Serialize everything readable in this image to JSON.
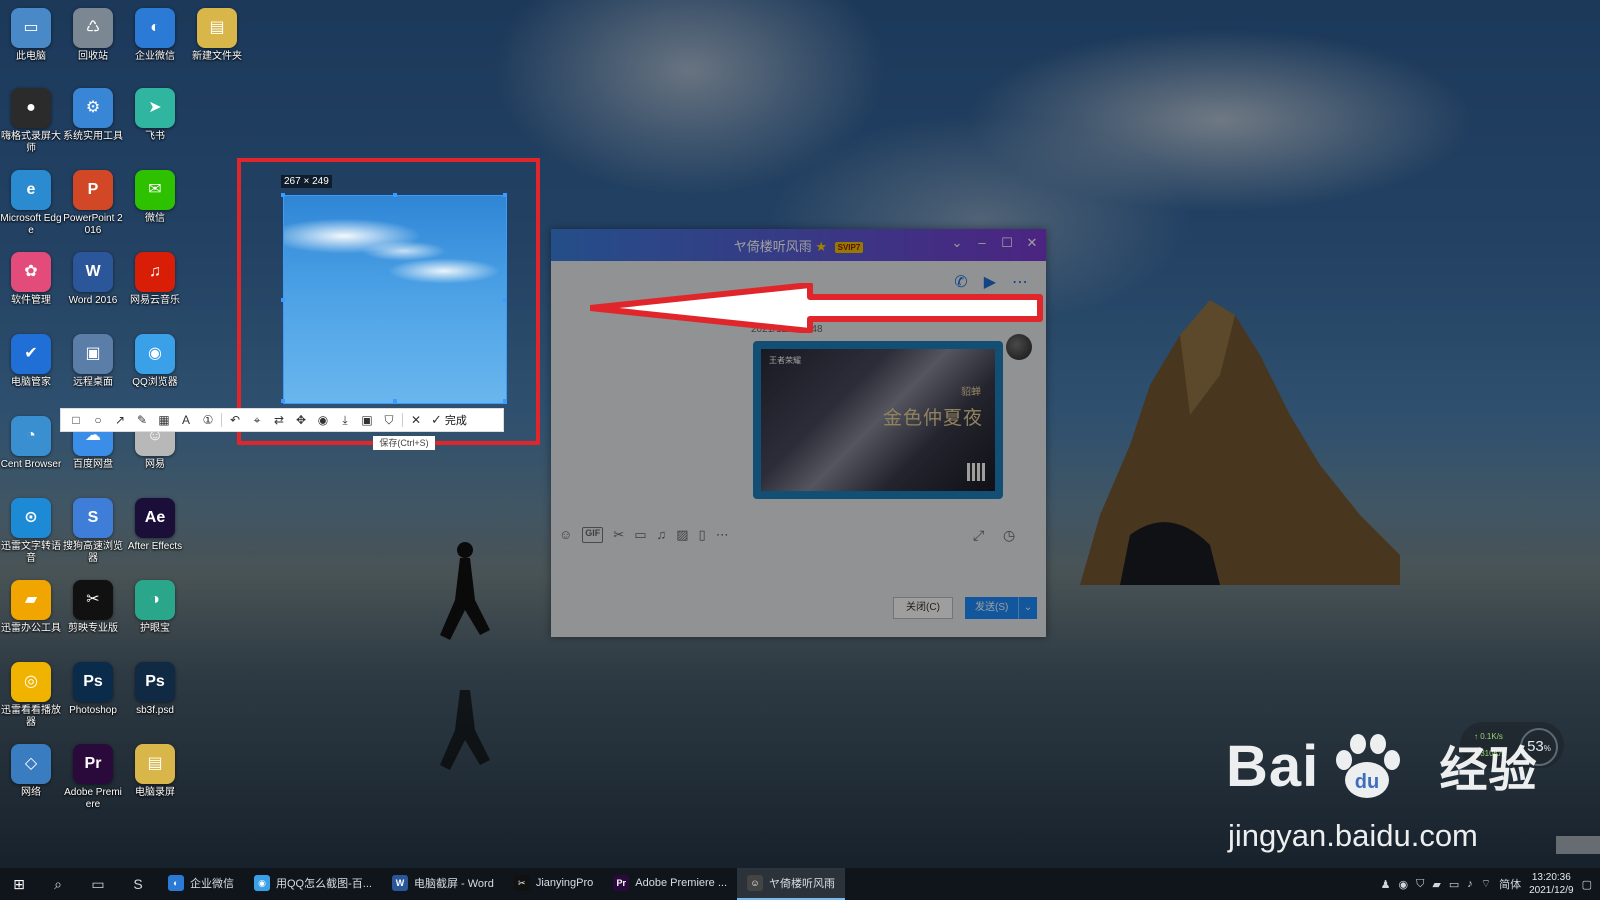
{
  "desktop": {
    "icons": [
      {
        "label": "此电脑",
        "glyph": "▭",
        "color": "#4a89c8"
      },
      {
        "label": "回收站",
        "glyph": "♺",
        "color": "#7b8792"
      },
      {
        "label": "企业微信",
        "glyph": "◐",
        "color": "#2b7bd6"
      },
      {
        "label": "新建文件夹",
        "glyph": "▤",
        "color": "#d9b64a"
      },
      {
        "label": "嗨格式录屏大师",
        "glyph": "●",
        "color": "#2b2b2b"
      },
      {
        "label": "系统实用工具",
        "glyph": "⚙",
        "color": "#3a86d6"
      },
      {
        "label": "飞书",
        "glyph": "➤",
        "color": "#2fb5a0"
      },
      {
        "label": "Microsoft Edge",
        "glyph": "e",
        "color": "#2a8bd0"
      },
      {
        "label": "PowerPoint 2016",
        "glyph": "P",
        "color": "#d24726"
      },
      {
        "label": "微信",
        "glyph": "✉",
        "color": "#2dc100"
      },
      {
        "label": "软件管理",
        "glyph": "✿",
        "color": "#e34b7a"
      },
      {
        "label": "Word 2016",
        "glyph": "W",
        "color": "#2b579a"
      },
      {
        "label": "网易云音乐",
        "glyph": "♫",
        "color": "#d81e06"
      },
      {
        "label": "电脑管家",
        "glyph": "✔",
        "color": "#1f6fd6"
      },
      {
        "label": "远程桌面",
        "glyph": "▣",
        "color": "#5a7ea8"
      },
      {
        "label": "QQ浏览器",
        "glyph": "◉",
        "color": "#3aa0e8"
      },
      {
        "label": "Cent Browser",
        "glyph": "◔",
        "color": "#3a8fd0"
      },
      {
        "label": "百度网盘",
        "glyph": "☁",
        "color": "#3a8ee8"
      },
      {
        "label": "网易",
        "glyph": "☺",
        "color": "#b8b8b8"
      },
      {
        "label": "迅雷文字转语音",
        "glyph": "⊙",
        "color": "#1d8ad6"
      },
      {
        "label": "搜狗高速浏览器",
        "glyph": "S",
        "color": "#3f7ed8"
      },
      {
        "label": "After Effects",
        "glyph": "Ae",
        "color": "#1b0f3a"
      },
      {
        "label": "迅雷办公工具",
        "glyph": "▰",
        "color": "#f0a500"
      },
      {
        "label": "剪映专业版",
        "glyph": "✂",
        "color": "#111111"
      },
      {
        "label": "护眼宝",
        "glyph": "◑",
        "color": "#2aa68a"
      },
      {
        "label": "迅雷看看播放器",
        "glyph": "◎",
        "color": "#f0b400"
      },
      {
        "label": "Photoshop",
        "glyph": "Ps",
        "color": "#0a2c4a"
      },
      {
        "label": "sb3f.psd",
        "glyph": "Ps",
        "color": "#102a44"
      },
      {
        "label": "网络",
        "glyph": "◇",
        "color": "#3a7cc0"
      },
      {
        "label": "Adobe Premiere",
        "glyph": "Pr",
        "color": "#2a0a3a"
      },
      {
        "label": "电脑录屏",
        "glyph": "▤",
        "color": "#d9b64a"
      }
    ]
  },
  "capture": {
    "size_label": "267 × 249",
    "tooltip": "保存(Ctrl+S)",
    "toolbar": {
      "tools": [
        {
          "name": "rectangle-tool",
          "glyph": "□"
        },
        {
          "name": "ellipse-tool",
          "glyph": "○"
        },
        {
          "name": "arrow-tool",
          "glyph": "↗"
        },
        {
          "name": "pen-tool",
          "glyph": "✎"
        },
        {
          "name": "mosaic-tool",
          "glyph": "▦"
        },
        {
          "name": "text-tool",
          "glyph": "A"
        },
        {
          "name": "number-tool",
          "glyph": "①"
        },
        {
          "name": "undo-tool",
          "glyph": "↶"
        },
        {
          "name": "ocr-tool",
          "glyph": "⌖"
        },
        {
          "name": "translate-tool",
          "glyph": "⇄"
        },
        {
          "name": "pin-tool",
          "glyph": "✥"
        },
        {
          "name": "screen-record-tool",
          "glyph": "◉"
        },
        {
          "name": "download-tool",
          "glyph": "⤓"
        },
        {
          "name": "save-tool",
          "glyph": "▣"
        },
        {
          "name": "bookmark-tool",
          "glyph": "⛉"
        },
        {
          "name": "cancel-tool",
          "glyph": "✕"
        }
      ],
      "done_label": "完成"
    }
  },
  "chat": {
    "title": "ヤ倚楼听风雨",
    "vip_badge": "SVIP7",
    "message_time": "2021/12/9 11:48",
    "poster": {
      "logo_text": "王者荣耀",
      "title": "金色仲夏夜",
      "subtitle": "貂蝉"
    },
    "close_button": "关闭(C)",
    "send_button": "发送(S)",
    "toolbar_gif": "GIF"
  },
  "net": {
    "up": "0.1K/s",
    "down": "310K/s",
    "percent": "53",
    "percent_unit": "%"
  },
  "watermark": {
    "logo": "Bai",
    "logo_suffix": "经验",
    "url": "jingyan.baidu.com"
  },
  "taskbar": {
    "apps": [
      {
        "label": "企业微信",
        "glyph": "◐",
        "color": "#2b7bd6",
        "active": false
      },
      {
        "label": "用QQ怎么截图-百...",
        "glyph": "◉",
        "color": "#3aa0e8",
        "active": false
      },
      {
        "label": "电脑截屏 - Word",
        "glyph": "W",
        "color": "#2b579a",
        "active": false
      },
      {
        "label": "JianyingPro",
        "glyph": "✂",
        "color": "#111111",
        "active": false
      },
      {
        "label": "Adobe Premiere ...",
        "glyph": "Pr",
        "color": "#2a0a3a",
        "active": false
      },
      {
        "label": "ヤ倚楼听风雨",
        "glyph": "☺",
        "color": "#444444",
        "active": true
      }
    ],
    "ime": "简体",
    "time": "13:20:36",
    "date": "2021/12/9"
  }
}
